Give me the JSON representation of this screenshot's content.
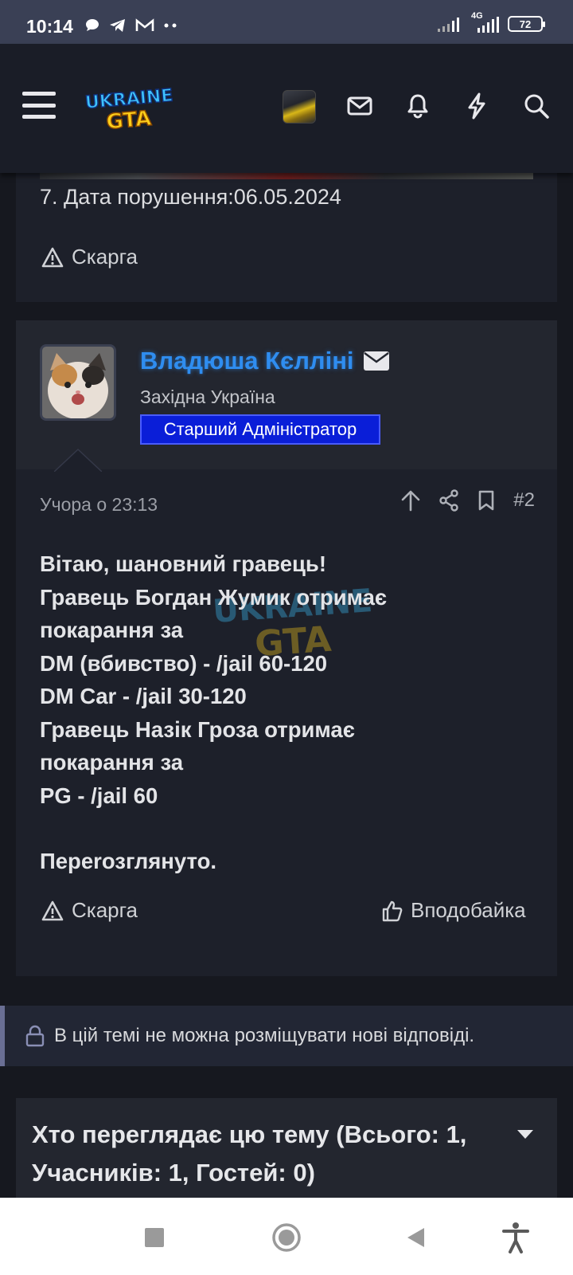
{
  "status_bar": {
    "time": "10:14",
    "network": "4G",
    "battery": "72"
  },
  "header": {
    "logo_text_top": "UKRAINE",
    "logo_text_bottom": "GTA",
    "icons": [
      "menu-icon",
      "mail-icon",
      "bell-icon",
      "lightning-icon",
      "search-icon"
    ]
  },
  "post1": {
    "line": "7. Дата порушення:06.05.2024",
    "report_label": "Скарга"
  },
  "post2": {
    "username": "Владюша Кєлліні",
    "location": "Західна Україна",
    "role": "Старший Адміністратор",
    "time": "Учора о 23:13",
    "post_number": "#2",
    "body_lines": [
      "Вітаю, шановний гравець!",
      "Гравець Богдан Жумик отримає",
      "покарання за",
      "DM (вбивство) - /jail 60-120",
      "DM Car - /jail 30-120",
      "Гравець Назік Гроза отримає",
      "покарання за",
      "PG - /jail 60",
      "",
      "Переrозглянуто."
    ],
    "report_label": "Скарга",
    "like_label": "Вподобайка"
  },
  "locked_notice": "В цій темі не можна розміщувати нові відповіді.",
  "viewers": {
    "title": "Хто переглядає цю тему (Всього: 1, Учасників: 1, Гостей: 0)"
  },
  "colors": {
    "accent_blue": "#2f8df0",
    "role_badge": "#0a1ed8",
    "background": "#16181f"
  }
}
